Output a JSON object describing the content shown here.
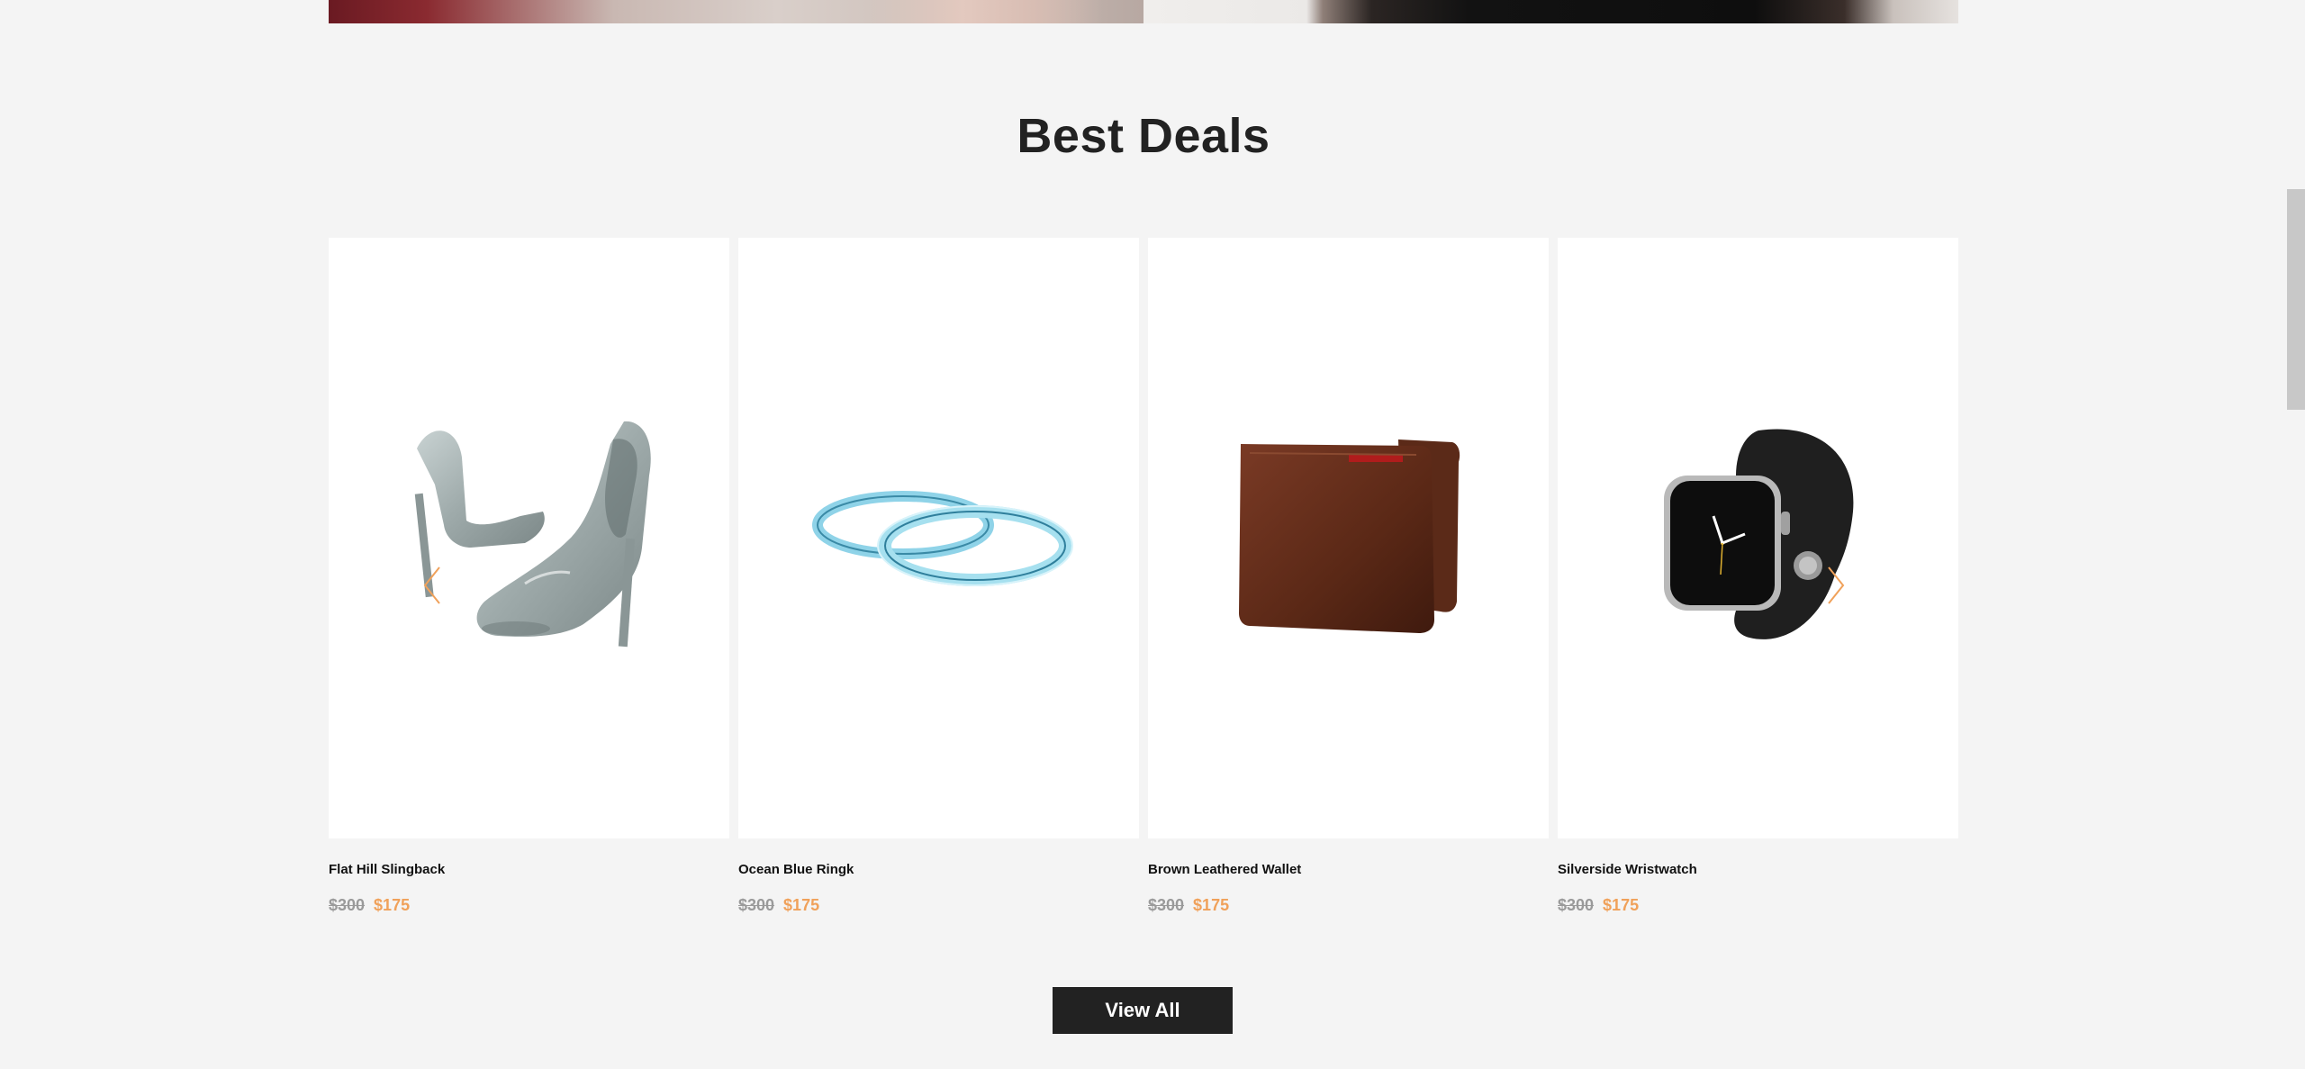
{
  "section": {
    "title": "Best Deals"
  },
  "products": [
    {
      "name": "Flat Hill Slingback",
      "price_old": "$300",
      "price_new": "$175",
      "image": "high-heel-shoes"
    },
    {
      "name": "Ocean Blue Ringk",
      "price_old": "$300",
      "price_new": "$175",
      "image": "bracelet-rings"
    },
    {
      "name": "Brown Leathered Wallet",
      "price_old": "$300",
      "price_new": "$175",
      "image": "leather-wallet"
    },
    {
      "name": "Silverside Wristwatch",
      "price_old": "$300",
      "price_new": "$175",
      "image": "smartwatch"
    }
  ],
  "carousel": {
    "prev_icon": "chevron-left-icon",
    "next_icon": "chevron-right-icon",
    "arrow_color": "#f0a15a"
  },
  "buttons": {
    "view_all": "View All"
  },
  "colors": {
    "accent": "#f0a15a",
    "old_price": "#9a9a9a",
    "button_bg": "#222222",
    "page_bg": "#f4f4f4"
  }
}
